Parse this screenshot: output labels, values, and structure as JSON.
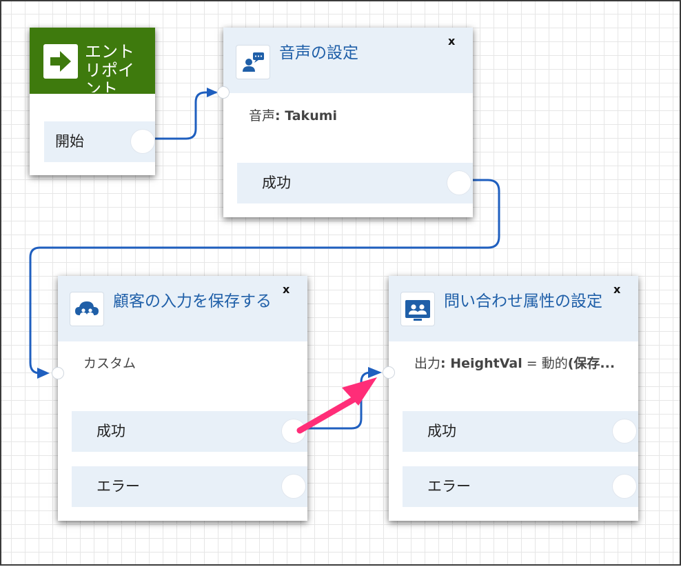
{
  "colors": {
    "entry_header": "#3e7a0d",
    "block_header": "#e8f0f8",
    "title_text": "#1f5fa8",
    "wire": "#1f5fbf",
    "highlight_arrow": "#ff2d78"
  },
  "entry_point": {
    "title": "エントリポイント",
    "icon": "arrow-right-icon",
    "branch_label": "開始"
  },
  "set_voice": {
    "title": "音声の設定",
    "icon": "voice-chat-icon",
    "close_label": "x",
    "param": {
      "key": "音声",
      "value": ": Takumi"
    },
    "branches": [
      {
        "label": "成功"
      }
    ]
  },
  "store_input": {
    "title": "顧客の入力を保存する",
    "icon": "cloud-users-icon",
    "close_label": "x",
    "param": {
      "key": "カスタム"
    },
    "branches": [
      {
        "label": "成功"
      },
      {
        "label": "エラー"
      }
    ]
  },
  "set_attributes": {
    "title": "問い合わせ属性の設定",
    "icon": "contact-group-icon",
    "close_label": "x",
    "param": {
      "key": "出力",
      "value": ": HeightVal",
      "tail": " = 動的",
      "tail2": "(保存...",
      "text_prefix": ""
    },
    "branches": [
      {
        "label": "成功"
      },
      {
        "label": "エラー"
      }
    ]
  }
}
